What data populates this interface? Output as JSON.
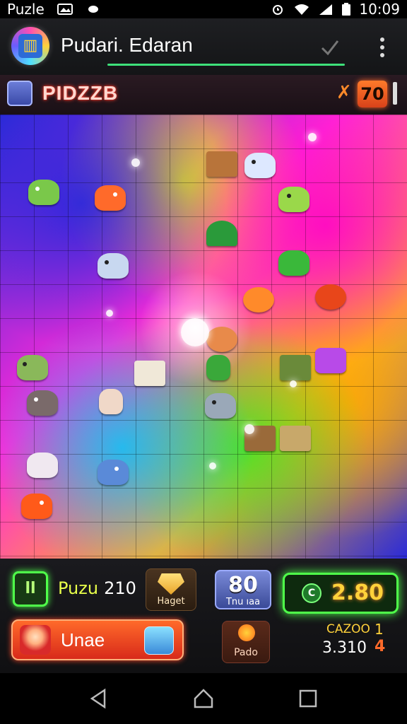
{
  "status_bar": {
    "app_label": "Puzle",
    "time": "10:09"
  },
  "app_bar": {
    "title": "Pudari. Edaran"
  },
  "game_header": {
    "title": "PIDZZB",
    "score": "70"
  },
  "hud": {
    "puzzle_label": "Puzu",
    "puzzle_value": "210",
    "green_icon_text": "ll",
    "hunter_label": "Haget",
    "eighty_value": "80",
    "eighty_label": "Tnu ıaa",
    "coin_symbol": "C",
    "coin_value": "2.80",
    "line_label": "Unae",
    "pickle_label": "Pado",
    "stat1_label": "CAZOO",
    "stat1_value": "1",
    "stat2_label": "3.310",
    "stat2_value": "4"
  },
  "colors": {
    "accent_green": "#4fff4a",
    "accent_orange": "#ff6a2a"
  }
}
